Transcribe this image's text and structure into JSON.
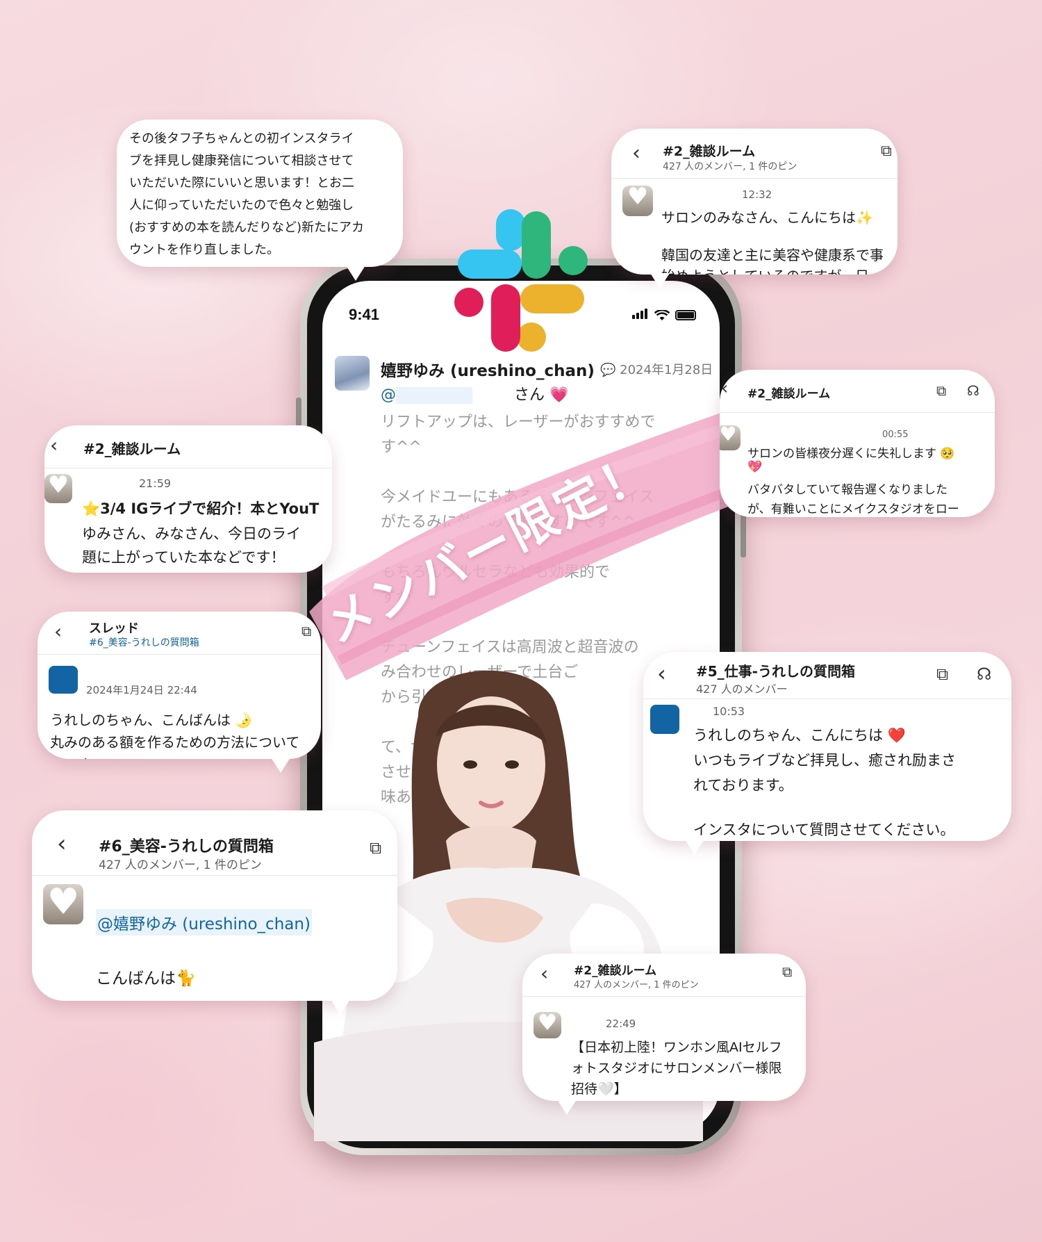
{
  "phone": {
    "status_time": "9:41",
    "sender_name": "嬉野ゆみ (ureshino_chan)",
    "date": "2024年1月28日",
    "mention_prefix": "@",
    "mention_suffix": "さん",
    "body_lines": [
      "リフトアップは、レーザーがおすすめで",
      "す^^",
      "今メイドユーにもあるチューンフェイス",
      "がたるみに効くのでおすすめです^^",
      "もちろんウルセラなども効果的で",
      "すが",
      "チューンフェイスは高周波と超音波の",
      "み合わせのレーザーで土台ご",
      "から引き上げ",
      "て、サロンの",
      "させてい",
      "味ある"
    ]
  },
  "banner": {
    "text": "メンバー限定！"
  },
  "cards": {
    "post_text": {
      "lines": [
        "その後タフ子ちゃんとの初インスタライ",
        "ブを拝見し健康発信について相談させて",
        "いただいた際にいいと思います！とお二",
        "人に仰っていただいたので色々と勉強し",
        "(おすすめの本を読んだりなど)新たにアカ",
        "ウントを作り直しました。"
      ]
    },
    "top_right": {
      "channel": "#2_雑談ルーム",
      "meta": "427 人のメンバー, 1 件のピン",
      "time": "12:32",
      "line1": "サロンのみなさん、こんにちは✨",
      "line2": "韓国の友達と主に美容や健康系で事",
      "line3": "始めようとしているのですが、日"
    },
    "mid_right": {
      "channel": "#2_雑談ルーム",
      "time": "00:55",
      "line1": "サロンの皆様夜分遅くに失礼します 🥺",
      "line2": "💖",
      "line3": "バタバタしていて報告遅くなりました",
      "line4": "が、有難いことにメイクスタジオをロー"
    },
    "left_ig": {
      "channel": "#2_雑談ルーム",
      "time": "21:59",
      "line1": "⭐3/4 IGライブで紹介！本とYouT",
      "line2": "ゆみさん、みなさん、今日のライ",
      "line3": "題に上がっていた本などです！"
    },
    "thread": {
      "title": "スレッド",
      "channel": "#6_美容-うれしの質問箱",
      "time": "2024年1月24日 22:44",
      "line1": "うれしのちゃん、こんばんは 🌛",
      "line2": "丸みのある額を作るための方法について",
      "line3": "いです！"
    },
    "work": {
      "channel": "#5_仕事-うれしの質問箱",
      "meta": "427 人のメンバー",
      "time": "10:53",
      "line1": "うれしのちゃん、こんにちは ❤️",
      "line2": "いつもライブなど拝見し、癒され励まさ",
      "line3": "れております。",
      "line4": "インスタについて質問させてください。"
    },
    "beauty": {
      "channel": "#6_美容-うれしの質問箱",
      "meta": "427 人のメンバー, 1 件のピン",
      "mention": "@嬉野ゆみ (ureshino_chan)",
      "line1": "こんばんは🐈"
    },
    "bottom": {
      "channel": "#2_雑談ルーム",
      "meta": "427 人のメンバー, 1 件のピン",
      "time": "22:49",
      "line1": "【日本初上陸！ワンホン風AIセルフ",
      "line2": "ォトスタジオにサロンメンバー様限",
      "line3": "招待🤍】"
    }
  },
  "colors": {
    "slack_blue": "#36c5f0",
    "slack_green": "#2eb67d",
    "slack_red": "#e01e5a",
    "slack_yellow": "#ecb22e",
    "link_blue": "#1264a3",
    "brush_pink": "#f1a9c6"
  }
}
